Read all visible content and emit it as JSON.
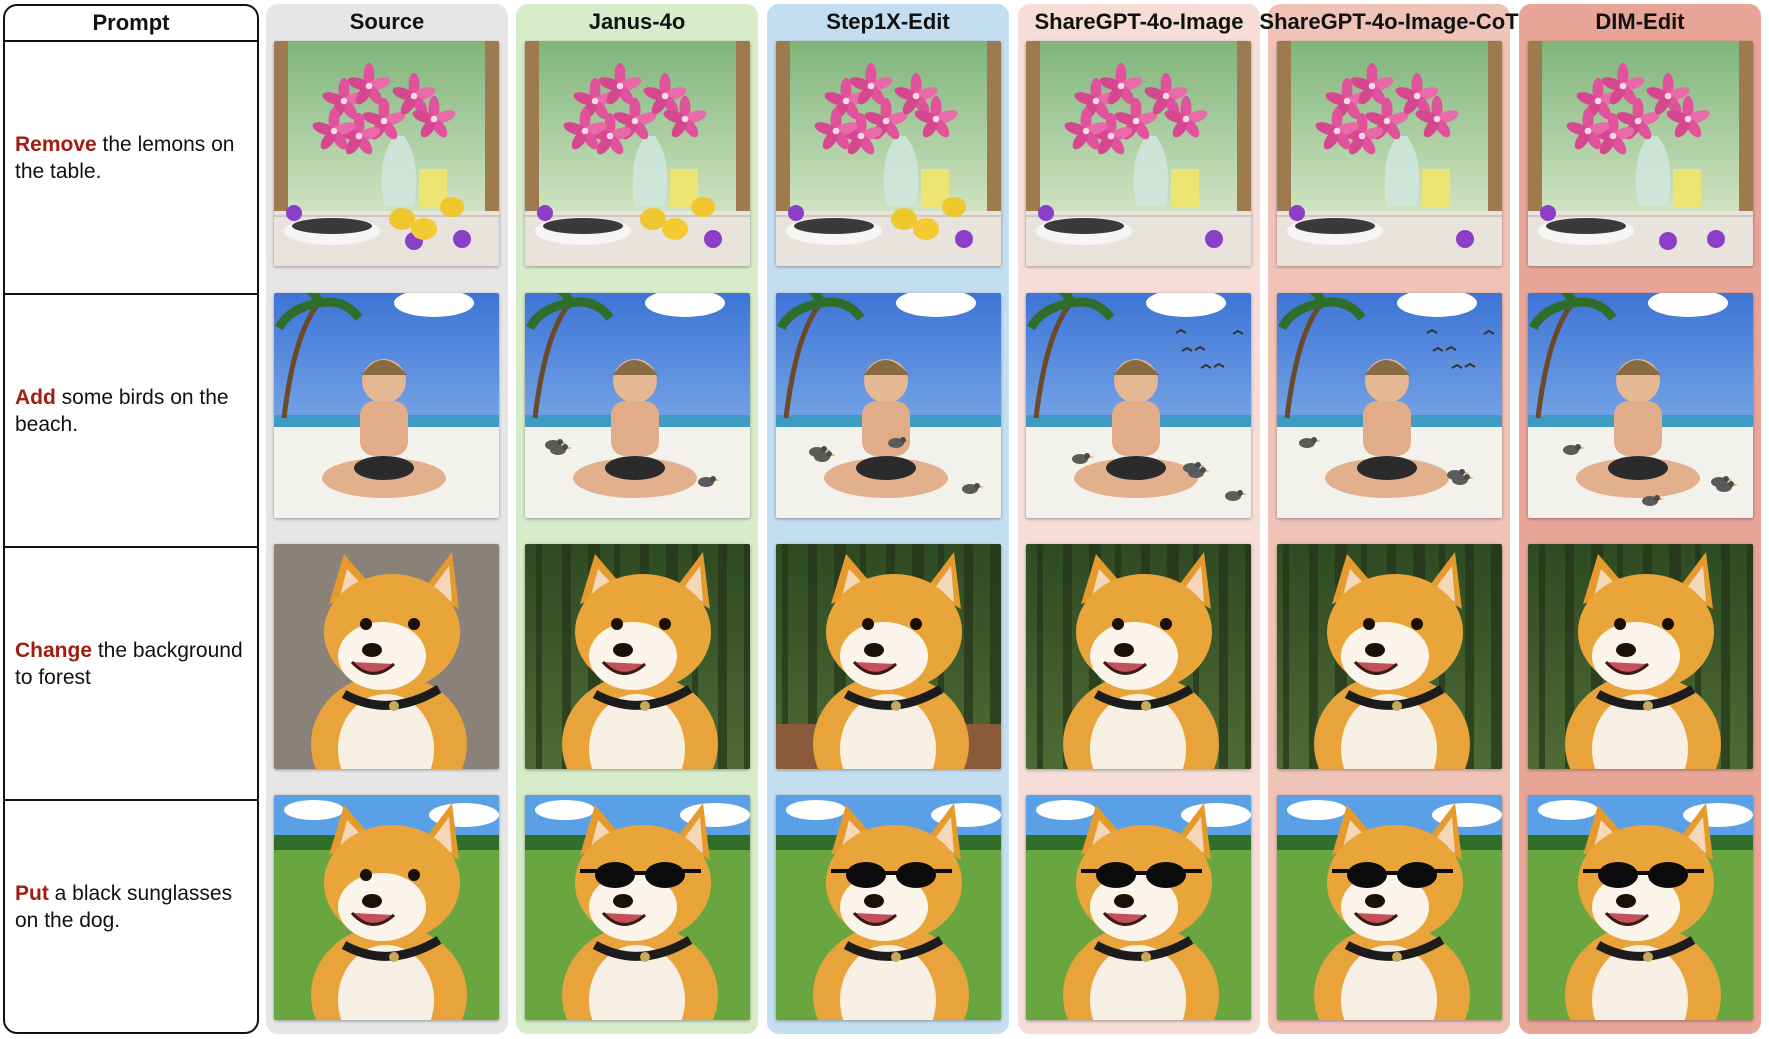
{
  "header": {
    "prompt": "Prompt"
  },
  "prompts": [
    {
      "verb": "Remove",
      "rest": " the lemons on the table."
    },
    {
      "verb": "Add",
      "rest": " some birds on the beach."
    },
    {
      "verb": "Change",
      "rest": " the background to forest"
    },
    {
      "verb": "Put",
      "rest": " a black sunglasses on the dog."
    }
  ],
  "methods": [
    {
      "name": "Source",
      "bg": "#e6e6e6"
    },
    {
      "name": "Janus-4o",
      "bg": "#d7eccb"
    },
    {
      "name": "Step1X-Edit",
      "bg": "#c4def1"
    },
    {
      "name": "ShareGPT-4o-Image",
      "bg": "#f6ddd8"
    },
    {
      "name": "ShareGPT-4o-Image-CoT",
      "bg": "#f0c3b9"
    },
    {
      "name": "DIM-Edit",
      "bg": "#e8a597"
    }
  ],
  "colors": {
    "verb": "#a11d12"
  },
  "images": {
    "row1": "still-life-lilies",
    "row2": "boy-on-beach",
    "row3": "shiba-portrait",
    "row4": "shiba-on-meadow"
  }
}
